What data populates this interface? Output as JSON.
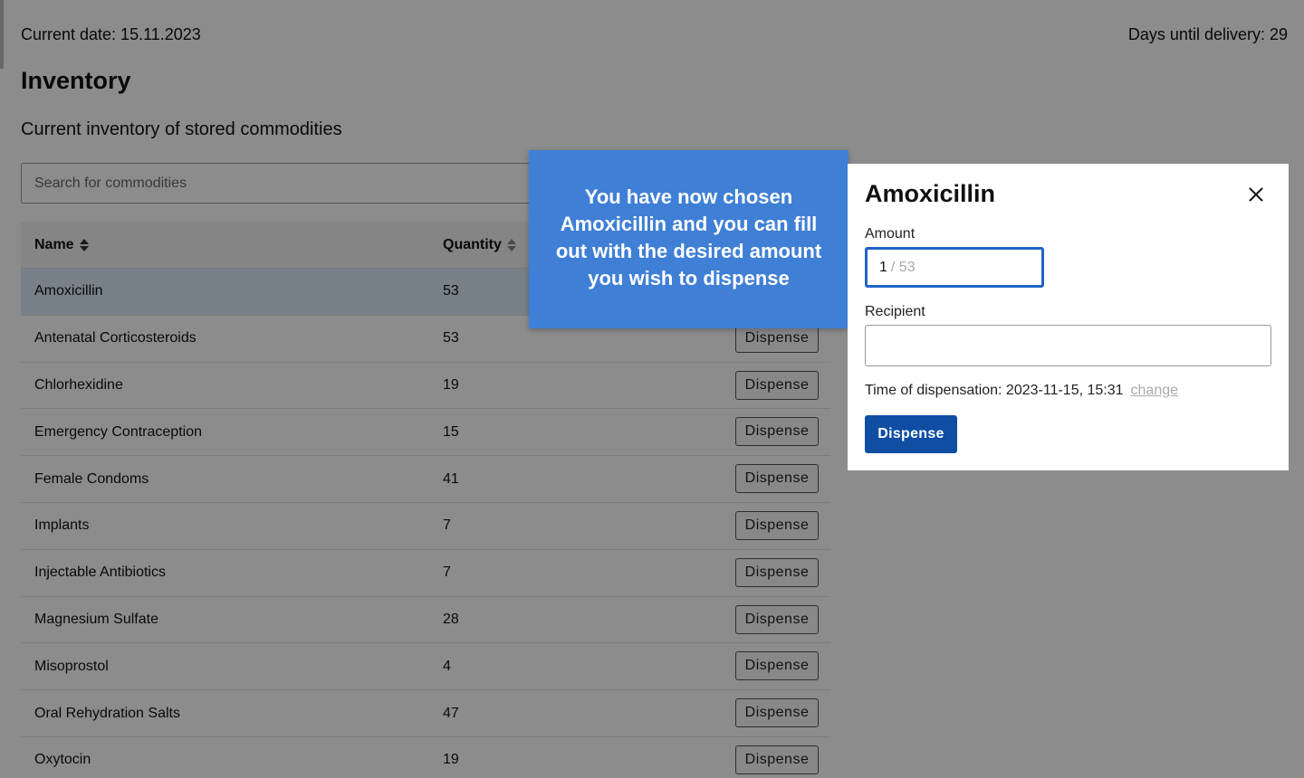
{
  "header": {
    "current_date": "Current date: 15.11.2023",
    "days_until_delivery": "Days until delivery: 29"
  },
  "page": {
    "title": "Inventory",
    "subtitle": "Current inventory of stored commodities"
  },
  "search": {
    "placeholder": "Search for commodities"
  },
  "table": {
    "columns": {
      "name": "Name",
      "quantity": "Quantity"
    },
    "dispense_label": "Dispense",
    "rows": [
      {
        "name": "Amoxicillin",
        "quantity": "53"
      },
      {
        "name": "Antenatal Corticosteroids",
        "quantity": "53"
      },
      {
        "name": "Chlorhexidine",
        "quantity": "19"
      },
      {
        "name": "Emergency Contraception",
        "quantity": "15"
      },
      {
        "name": "Female Condoms",
        "quantity": "41"
      },
      {
        "name": "Implants",
        "quantity": "7"
      },
      {
        "name": "Injectable Antibiotics",
        "quantity": "7"
      },
      {
        "name": "Magnesium Sulfate",
        "quantity": "28"
      },
      {
        "name": "Misoprostol",
        "quantity": "4"
      },
      {
        "name": "Oral Rehydration Salts",
        "quantity": "47"
      },
      {
        "name": "Oxytocin",
        "quantity": "19"
      }
    ]
  },
  "tooltip": {
    "text": "You have now chosen Amoxicillin and you can fill out with the desired amount you wish to dispense"
  },
  "modal": {
    "title": "Amoxicillin",
    "amount_label": "Amount",
    "amount_value": "1",
    "amount_max": "/ 53",
    "recipient_label": "Recipient",
    "recipient_value": "",
    "time_text": "Time of dispensation: 2023-11-15, 15:31",
    "change_link": "change",
    "submit_label": "Dispense"
  },
  "colors": {
    "overlay": "#000000",
    "primary": "#0f4ea3",
    "tooltip": "#3f7fd6",
    "selected_row": "#dbe9f7"
  }
}
